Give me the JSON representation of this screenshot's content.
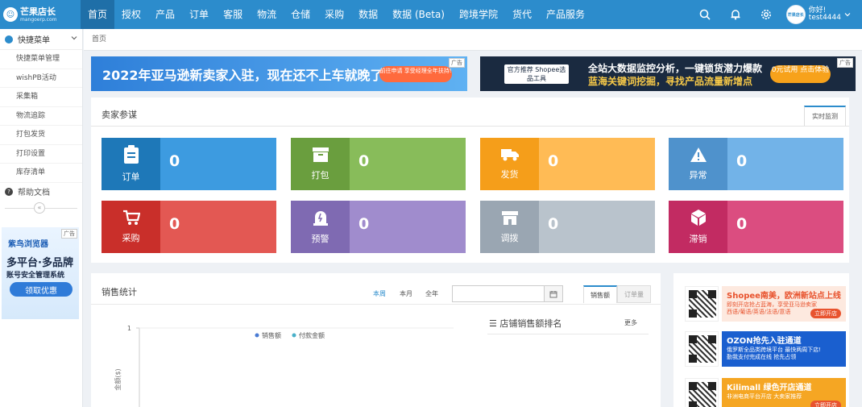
{
  "logo": {
    "name": "芒果店长",
    "domain": "mangoerp.com"
  },
  "nav": [
    {
      "label": "首页",
      "active": true
    },
    {
      "label": "授权"
    },
    {
      "label": "产品"
    },
    {
      "label": "订单"
    },
    {
      "label": "客服"
    },
    {
      "label": "物流"
    },
    {
      "label": "仓储"
    },
    {
      "label": "采购"
    },
    {
      "label": "数据"
    },
    {
      "label": "数据 (Beta)"
    },
    {
      "label": "跨境学院"
    },
    {
      "label": "货代"
    },
    {
      "label": "产品服务"
    }
  ],
  "user": {
    "greeting": "你好!",
    "name": "test4444",
    "avatar_text": "芒果店长"
  },
  "sidebar": {
    "header": "快捷菜单",
    "items": [
      "快捷菜单管理",
      "wishPB活动",
      "采集箱",
      "物流追踪",
      "打包发货",
      "打印设置",
      "库存清单"
    ],
    "help": "帮助文档",
    "ad": {
      "tag": "广告",
      "brand": "紫鸟浏览器",
      "line1": "多平台·多品牌",
      "line2": "账号安全管理系统",
      "cta": "领取优惠"
    }
  },
  "breadcrumb": "首页",
  "banners": [
    {
      "tag": "广告",
      "text": "2022年亚马逊新卖家入驻，现在还不上车就晚了!",
      "cta": "前往申请 享受经理全年扶持!"
    },
    {
      "tag": "广告",
      "badge": "官方推荐 Shopee选品工具",
      "line1": "全站大数据监控分析，一键锁货潜力爆款",
      "line2": "蓝海关键词挖掘，寻找产品流量新增点",
      "cta": "0元试用 点击体验"
    }
  ],
  "section": {
    "title": "卖家参谋",
    "tab": "实时监测",
    "cards": [
      {
        "label": "订单",
        "value": "0",
        "icon": "clipboard-icon",
        "dark": "#1e78b8",
        "light": "#3d9be0"
      },
      {
        "label": "打包",
        "value": "0",
        "icon": "archive-box-icon",
        "dark": "#6a9e3e",
        "light": "#88bc5a"
      },
      {
        "label": "发货",
        "value": "0",
        "icon": "truck-icon",
        "dark": "#f59e1a",
        "light": "#ffbb55"
      },
      {
        "label": "异常",
        "value": "0",
        "icon": "warning-icon",
        "dark": "#4f92cc",
        "light": "#72b3e8"
      },
      {
        "label": "采购",
        "value": "0",
        "icon": "cart-icon",
        "dark": "#c92f2a",
        "light": "#e35853"
      },
      {
        "label": "预警",
        "value": "0",
        "icon": "alarm-icon",
        "dark": "#7f6ab2",
        "light": "#a08ccd"
      },
      {
        "label": "调拨",
        "value": "0",
        "icon": "store-icon",
        "dark": "#9aa6b2",
        "light": "#b9c3cc"
      },
      {
        "label": "滞销",
        "value": "0",
        "icon": "cube-icon",
        "dark": "#c22b62",
        "light": "#db4d80"
      }
    ]
  },
  "sales": {
    "title": "销售统计",
    "ranges": [
      "本周",
      "本月",
      "全年"
    ],
    "active_range": "本周",
    "tabs": [
      "销售额",
      "订单量"
    ],
    "active_tab": "销售额",
    "rank_title": "店铺销售额排名",
    "more": "更多"
  },
  "chart_data": {
    "type": "line",
    "series": [
      {
        "name": "销售额",
        "values": []
      },
      {
        "name": "付款金额",
        "values": []
      }
    ],
    "ylabel": "金额($)",
    "yticks": [
      "1"
    ],
    "colors": [
      "#4a7bd4",
      "#49b0c9"
    ]
  },
  "right_ads": [
    {
      "title": "Shopee南美，欧洲新站点上线",
      "sub": "即刻开店抢占蓝海，享受亚马逊卖家",
      "sub2": "西语/葡语/英语/法语/意语",
      "cta": "立即开店",
      "bg": "#fde9df",
      "color": "#e8532e"
    },
    {
      "title": "OZON抢先入驻通道",
      "sub": "俄罗斯全品类跨境平台 最快两周下店!",
      "sub2": "勤我支付完成在线 抢先占领",
      "cta": "",
      "bg": "#1a5fcf",
      "color": "#ffffff"
    },
    {
      "title": "Kilimall 绿色开店通道",
      "sub": "非洲电商平台开店 大卖家推荐",
      "sub2": "",
      "cta": "立即开店",
      "bg": "#f5a623",
      "color": "#ffffff"
    }
  ]
}
